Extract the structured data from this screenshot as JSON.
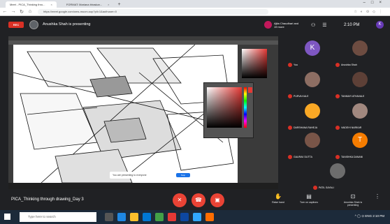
{
  "browser": {
    "tab1": "Meet - PICA_Thinking thro...",
    "tab2": "FORMAT: Mariana bhaskar...",
    "new_tab": "+",
    "url": "https://meet.google.com/oms-mucm-sop?pli=1&authuser=0"
  },
  "meet": {
    "rec_label": "REC",
    "presenting_text": "Anushka Shah is presenting",
    "others_text": "Ajita Chaudhari and 19 more",
    "time": "2:10 PM",
    "self_initial": "K",
    "meeting_name": "PICA_Thinking through drawing_Day 3",
    "raise_hand": "Raise hand",
    "turn_on_captions": "Turn on captions",
    "presenting_now": "Anushka Shah is presenting",
    "share_notice": "You are presenting to everyone",
    "stop_presenting": "Stop presenting"
  },
  "participants": [
    {
      "name": "You",
      "initial": "K",
      "color": "#7e57c2"
    },
    {
      "name": "Anushka Shah",
      "initial": "",
      "color": "#6d4c41"
    },
    {
      "name": "PURVA KALE",
      "initial": "",
      "color": "#8d6e63"
    },
    {
      "name": "TANMAYI ATHAVALE",
      "initial": "",
      "color": "#5d4037"
    },
    {
      "name": "DARSHANA RAHEJA",
      "initial": "",
      "color": "#f9a825"
    },
    {
      "name": "VAIDEHI NARKAR",
      "initial": "",
      "color": "#a1887f"
    },
    {
      "name": "GAURAV DUTTA",
      "initial": "",
      "color": "#795548"
    },
    {
      "name": "TANISHKA DANANI",
      "initial": "T",
      "color": "#f57c00"
    },
    {
      "name": "PATIL SAYALI",
      "initial": "",
      "color": "#6d6d6d"
    }
  ],
  "windows": {
    "search_placeholder": "Type here to search",
    "tray_time": "2:10 PM"
  },
  "colors": {
    "meet_bg": "#202124",
    "end_call": "#ea4335",
    "accent": "#1a73e8"
  }
}
